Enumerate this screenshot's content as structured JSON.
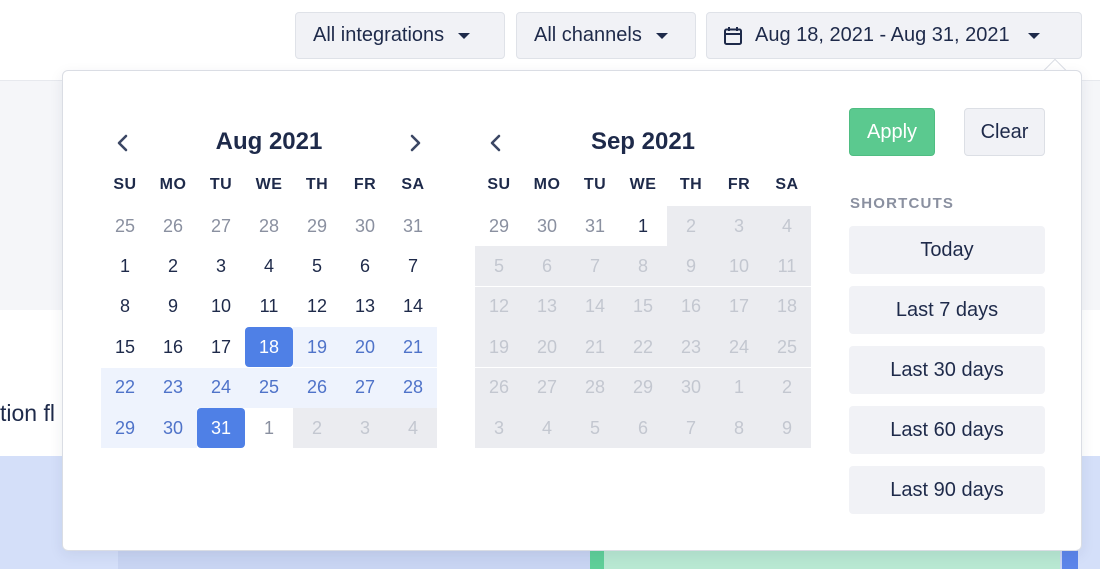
{
  "background": {
    "partial_title": "tion fl"
  },
  "toolbar": {
    "integrations_label": "All integrations",
    "channels_label": "All channels",
    "date_range_label": "Aug 18, 2021 - Aug 31, 2021"
  },
  "calendar": {
    "weekdays": [
      "SU",
      "MO",
      "TU",
      "WE",
      "TH",
      "FR",
      "SA"
    ],
    "months": [
      {
        "title": "Aug 2021",
        "weeks": [
          [
            {
              "d": "25",
              "s": "muted"
            },
            {
              "d": "26",
              "s": "muted"
            },
            {
              "d": "27",
              "s": "muted"
            },
            {
              "d": "28",
              "s": "muted"
            },
            {
              "d": "29",
              "s": "muted"
            },
            {
              "d": "30",
              "s": "muted"
            },
            {
              "d": "31",
              "s": "muted"
            }
          ],
          [
            {
              "d": "1",
              "s": "normal"
            },
            {
              "d": "2",
              "s": "normal"
            },
            {
              "d": "3",
              "s": "normal"
            },
            {
              "d": "4",
              "s": "normal"
            },
            {
              "d": "5",
              "s": "normal"
            },
            {
              "d": "6",
              "s": "normal"
            },
            {
              "d": "7",
              "s": "normal"
            }
          ],
          [
            {
              "d": "8",
              "s": "normal"
            },
            {
              "d": "9",
              "s": "normal"
            },
            {
              "d": "10",
              "s": "normal"
            },
            {
              "d": "11",
              "s": "normal"
            },
            {
              "d": "12",
              "s": "normal"
            },
            {
              "d": "13",
              "s": "normal"
            },
            {
              "d": "14",
              "s": "normal"
            }
          ],
          [
            {
              "d": "15",
              "s": "normal"
            },
            {
              "d": "16",
              "s": "normal"
            },
            {
              "d": "17",
              "s": "normal"
            },
            {
              "d": "18",
              "s": "selected"
            },
            {
              "d": "19",
              "s": "range"
            },
            {
              "d": "20",
              "s": "range"
            },
            {
              "d": "21",
              "s": "range"
            }
          ],
          [
            {
              "d": "22",
              "s": "range"
            },
            {
              "d": "23",
              "s": "range"
            },
            {
              "d": "24",
              "s": "range"
            },
            {
              "d": "25",
              "s": "range"
            },
            {
              "d": "26",
              "s": "range"
            },
            {
              "d": "27",
              "s": "range"
            },
            {
              "d": "28",
              "s": "range"
            }
          ],
          [
            {
              "d": "29",
              "s": "range"
            },
            {
              "d": "30",
              "s": "range"
            },
            {
              "d": "31",
              "s": "selected"
            },
            {
              "d": "1",
              "s": "muted"
            },
            {
              "d": "2",
              "s": "disabled"
            },
            {
              "d": "3",
              "s": "disabled"
            },
            {
              "d": "4",
              "s": "disabled"
            }
          ]
        ]
      },
      {
        "title": "Sep 2021",
        "weeks": [
          [
            {
              "d": "29",
              "s": "muted"
            },
            {
              "d": "30",
              "s": "muted"
            },
            {
              "d": "31",
              "s": "muted"
            },
            {
              "d": "1",
              "s": "normal"
            },
            {
              "d": "2",
              "s": "disabled"
            },
            {
              "d": "3",
              "s": "disabled"
            },
            {
              "d": "4",
              "s": "disabled"
            }
          ],
          [
            {
              "d": "5",
              "s": "disabled"
            },
            {
              "d": "6",
              "s": "disabled"
            },
            {
              "d": "7",
              "s": "disabled"
            },
            {
              "d": "8",
              "s": "disabled"
            },
            {
              "d": "9",
              "s": "disabled"
            },
            {
              "d": "10",
              "s": "disabled"
            },
            {
              "d": "11",
              "s": "disabled"
            }
          ],
          [
            {
              "d": "12",
              "s": "disabled"
            },
            {
              "d": "13",
              "s": "disabled"
            },
            {
              "d": "14",
              "s": "disabled"
            },
            {
              "d": "15",
              "s": "disabled"
            },
            {
              "d": "16",
              "s": "disabled"
            },
            {
              "d": "17",
              "s": "disabled"
            },
            {
              "d": "18",
              "s": "disabled"
            }
          ],
          [
            {
              "d": "19",
              "s": "disabled"
            },
            {
              "d": "20",
              "s": "disabled"
            },
            {
              "d": "21",
              "s": "disabled"
            },
            {
              "d": "22",
              "s": "disabled"
            },
            {
              "d": "23",
              "s": "disabled"
            },
            {
              "d": "24",
              "s": "disabled"
            },
            {
              "d": "25",
              "s": "disabled"
            }
          ],
          [
            {
              "d": "26",
              "s": "disabled"
            },
            {
              "d": "27",
              "s": "disabled"
            },
            {
              "d": "28",
              "s": "disabled"
            },
            {
              "d": "29",
              "s": "disabled"
            },
            {
              "d": "30",
              "s": "disabled"
            },
            {
              "d": "1",
              "s": "disabled"
            },
            {
              "d": "2",
              "s": "disabled"
            }
          ],
          [
            {
              "d": "3",
              "s": "disabled"
            },
            {
              "d": "4",
              "s": "disabled"
            },
            {
              "d": "5",
              "s": "disabled"
            },
            {
              "d": "6",
              "s": "disabled"
            },
            {
              "d": "7",
              "s": "disabled"
            },
            {
              "d": "8",
              "s": "disabled"
            },
            {
              "d": "9",
              "s": "disabled"
            }
          ]
        ]
      }
    ]
  },
  "actions": {
    "apply_label": "Apply",
    "clear_label": "Clear"
  },
  "shortcuts": {
    "heading": "SHORTCUTS",
    "items": [
      "Today",
      "Last 7 days",
      "Last 30 days",
      "Last 60 days",
      "Last 90 days"
    ]
  },
  "colors": {
    "accent": "#4f80e6",
    "range_bg": "#eef3fd",
    "apply": "#5bc98f",
    "text": "#1e2a4a"
  },
  "icons": {
    "date_dropdown": "calendar-icon",
    "caret": "caret-down-icon",
    "prev": "chevron-left-icon",
    "next": "chevron-right-icon"
  }
}
